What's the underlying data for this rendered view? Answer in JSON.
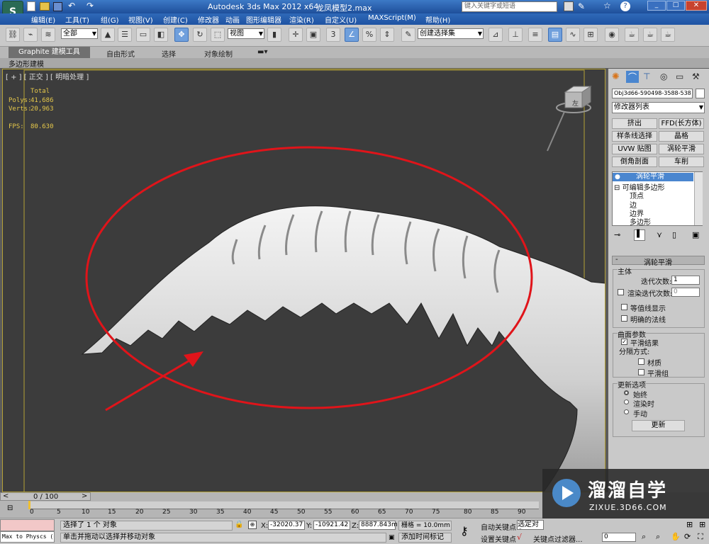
{
  "titlebar": {
    "app_title": "Autodesk 3ds Max  2012 x64",
    "file_name": "龙凤模型2.max",
    "search_placeholder": "键入关键字或短语"
  },
  "menu": [
    "编辑(E)",
    "工具(T)",
    "组(G)",
    "视图(V)",
    "创建(C)",
    "修改器",
    "动画",
    "图形编辑器",
    "渲染(R)",
    "自定义(U)",
    "MAXScript(M)",
    "帮助(H)"
  ],
  "toolbar": {
    "selection_filter": "全部",
    "ref_coord": "视图",
    "named_selection": "创建选择集",
    "snap_label": "3"
  },
  "ribbon": {
    "tabs": [
      "Graphite 建模工具",
      "自由形式",
      "选择",
      "对象绘制"
    ],
    "sub_tab": "多边形建模"
  },
  "viewport": {
    "label": "[ + ] [ 正交 ] [ 明暗处理 ]",
    "stats_header": "Total",
    "polys_label": "Polys:",
    "polys_value": "41,686",
    "verts_label": "Verts:",
    "verts_value": "20,963",
    "fps_label": "FPS:",
    "fps_value": "80.630",
    "viewcube_label": "左"
  },
  "command_panel": {
    "object_name": "Obj3d66-590498-3588-538",
    "modifier_list": "修改器列表",
    "modifier_buttons": [
      "挤出",
      "FFD(长方体)",
      "样条线选择",
      "晶格",
      "UVW 贴图",
      "涡轮平滑",
      "倒角剖面",
      "车削"
    ],
    "stack": [
      "涡轮平滑",
      "可编辑多边形",
      "顶点",
      "边",
      "边界",
      "多边形"
    ],
    "rollout_title": "涡轮平滑",
    "main_group": "主体",
    "iterations_label": "迭代次数:",
    "iterations_value": "1",
    "render_iters_label": "渲染迭代次数:",
    "render_iters_value": "0",
    "isoline_label": "等值线显示",
    "explicit_normals_label": "明确的法线",
    "surface_group": "曲面参数",
    "smooth_result_label": "平滑结果",
    "separate_label": "分隔方式:",
    "materials_label": "材质",
    "smoothing_groups_label": "平滑组",
    "update_group": "更新选项",
    "always_label": "始终",
    "when_rendering_label": "渲染时",
    "manually_label": "手动",
    "update_button": "更新"
  },
  "timeline": {
    "frame_range": "0 / 100",
    "ticks": [
      "0",
      "5",
      "10",
      "15",
      "20",
      "25",
      "30",
      "35",
      "40",
      "45",
      "50",
      "55",
      "60",
      "65",
      "70",
      "75",
      "80",
      "85",
      "90"
    ]
  },
  "status": {
    "script_listener": "Max to Physcs (",
    "selection_info": "选择了 1 个 对象",
    "prompt": "单击并拖动以选择并移动对象",
    "x_label": "X:",
    "x_value": "-32020.37",
    "y_label": "Y:",
    "y_value": "-10921.42",
    "z_label": "Z:",
    "z_value": "8887.843m",
    "grid": "栅格 = 10.0mm",
    "add_time_tag": "添加时间标记",
    "auto_key": "自动关键点",
    "set_key": "设置关键点",
    "selected": "选定对象",
    "key_filters": "关键点过滤器...",
    "frame_value": "0"
  },
  "watermark": {
    "brand": "溜溜自学",
    "url": "ZIXUE.3D66.COM"
  }
}
